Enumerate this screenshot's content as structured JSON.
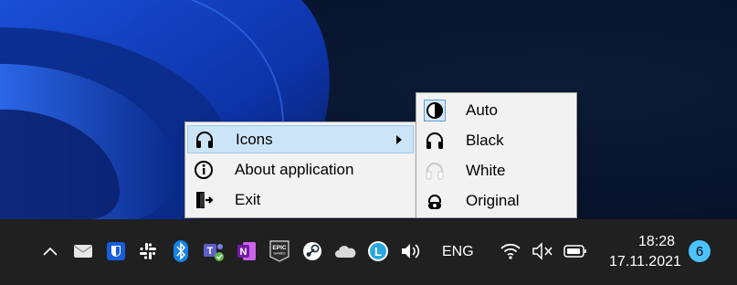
{
  "context_menu": {
    "items": [
      {
        "label": "Icons",
        "icon": "headphones-icon",
        "has_submenu": true,
        "highlighted": true
      },
      {
        "label": "About application",
        "icon": "info-icon"
      },
      {
        "label": "Exit",
        "icon": "exit-icon"
      }
    ]
  },
  "submenu": {
    "items": [
      {
        "label": "Auto",
        "icon": "contrast-icon",
        "selected": true
      },
      {
        "label": "Black",
        "icon": "headphones-black-icon"
      },
      {
        "label": "White",
        "icon": "headphones-white-icon"
      },
      {
        "label": "Original",
        "icon": "headphones-original-icon"
      }
    ]
  },
  "taskbar": {
    "language": "ENG",
    "time": "18:28",
    "date": "17.11.2021",
    "notification_count": "6",
    "tray_icons": [
      "chevron-up-icon",
      "mail-icon",
      "bitwarden-icon",
      "slack-icon",
      "bluetooth-icon",
      "teams-icon",
      "onenote-icon",
      "epic-games-icon",
      "steam-icon",
      "onedrive-icon",
      "l-app-icon",
      "speaker-icon",
      "wifi-icon",
      "mute-icon",
      "battery-icon"
    ]
  },
  "colors": {
    "menu_bg": "#f2f2f2",
    "highlight": "#cce4f7",
    "taskbar_bg": "#202020",
    "accent": "#4cc2ff"
  }
}
